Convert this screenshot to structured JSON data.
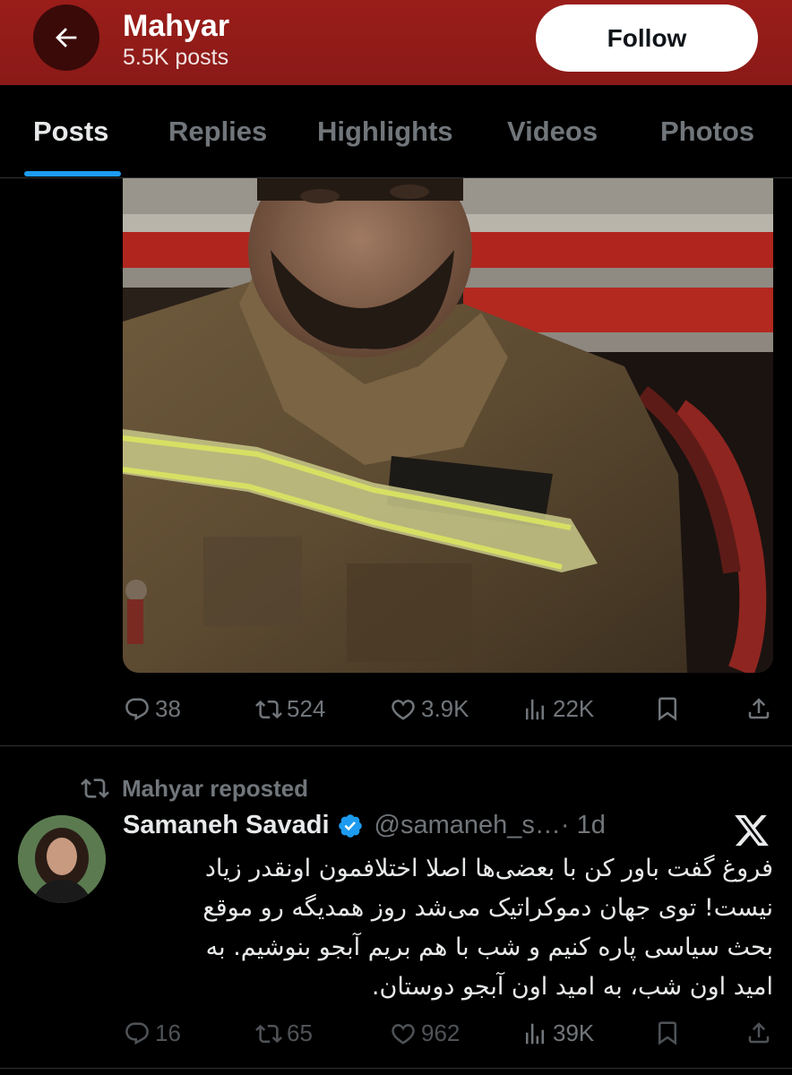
{
  "header": {
    "name": "Mahyar",
    "posts": "5.5K posts",
    "follow_label": "Follow"
  },
  "tabs": [
    {
      "label": "Posts",
      "active": true
    },
    {
      "label": "Replies",
      "active": false
    },
    {
      "label": "Highlights",
      "active": false
    },
    {
      "label": "Videos",
      "active": false
    },
    {
      "label": "Photos",
      "active": false
    }
  ],
  "post1": {
    "replies": "38",
    "reposts": "524",
    "likes": "3.9K",
    "views": "22K"
  },
  "repost": {
    "label": "Mahyar reposted",
    "author_name": "Samaneh Savadi",
    "handle": "@samaneh_s…",
    "time": "· 1d",
    "text_lines": [
      "فروغ گفت باور کن با بعضی‌ها اصلا اختلافمون اونقدر زیاد",
      "نیست! توی جهان دموکراتیک می‌شد روز همدیگه رو موقع",
      "بحث سیاسی پاره کنیم و شب با هم بریم آبجو بنوشیم. به",
      "امید اون شب، به امید اون آبجو دوستان."
    ],
    "replies": "16",
    "reposts": "65",
    "likes": "962",
    "views": "39K"
  },
  "colors": {
    "header_bg": "#8a1a17",
    "accent": "#1d9bf0",
    "muted": "#71767b"
  }
}
